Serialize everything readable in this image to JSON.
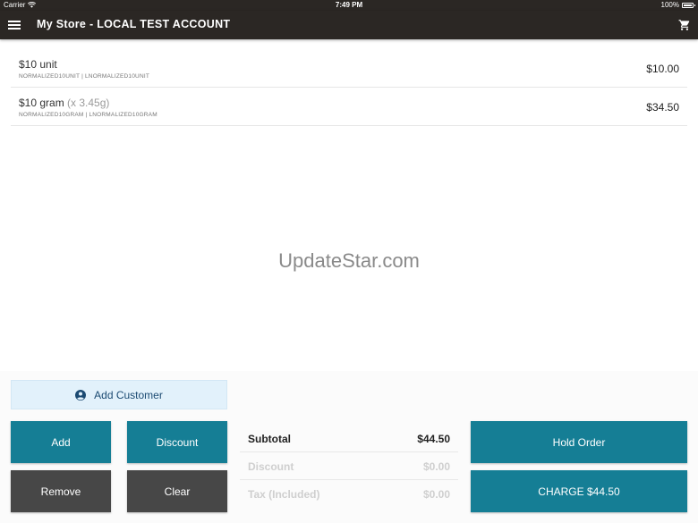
{
  "status_bar": {
    "carrier": "Carrier",
    "time": "7:49 PM",
    "battery": "100%",
    "battery_level": 1.0
  },
  "app_bar": {
    "title": "My Store - LOCAL TEST ACCOUNT",
    "menu_icon": "hamburger-icon",
    "cart_icon": "shopping-cart-icon"
  },
  "items": [
    {
      "name": "$10 unit",
      "qty": "",
      "sku": "NORMALIZED10UNIT | LNORMALIZED10UNIT",
      "price": "$10.00"
    },
    {
      "name": "$10 gram",
      "qty": "(x 3.45g)",
      "sku": "NORMALIZED10GRAM | LNORMALIZED10GRAM",
      "price": "$34.50"
    }
  ],
  "watermark": "UpdateStar.com",
  "customer": {
    "label": "Add Customer",
    "icon": "person-circle-icon"
  },
  "buttons": {
    "add": "Add",
    "discount": "Discount",
    "remove": "Remove",
    "clear": "Clear",
    "hold": "Hold Order",
    "charge": "CHARGE $44.50"
  },
  "summary": {
    "subtotal_label": "Subtotal",
    "subtotal_value": "$44.50",
    "discount_label": "Discount",
    "discount_value": "$0.00",
    "tax_label": "Tax (Included)",
    "tax_value": "$0.00"
  },
  "colors": {
    "app_bar": "#2b2724",
    "teal_button": "#157e95",
    "gray_button": "#474747",
    "customer_bg": "#e2f1fb",
    "customer_text": "#1b4a72"
  }
}
